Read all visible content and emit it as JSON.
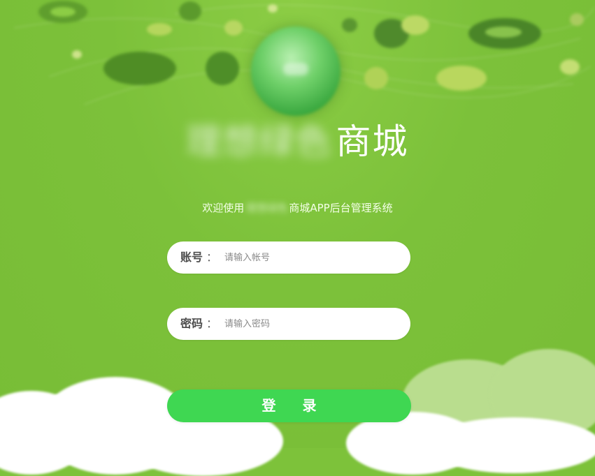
{
  "title": {
    "masked_text": "理想绿色",
    "visible_text": "商城"
  },
  "subtitle": {
    "prefix": "欢迎使用",
    "masked_text": "理想绿色",
    "suffix": "商城APP后台管理系统"
  },
  "account": {
    "label": "账号",
    "colon": "：",
    "placeholder": "请输入帐号",
    "value": ""
  },
  "password": {
    "label": "密码",
    "colon": "：",
    "placeholder": "请输入密码",
    "value": ""
  },
  "login_button": {
    "label": "登录"
  },
  "colors": {
    "background": "#7dc23a",
    "button": "#3fd752",
    "input_bg": "#ffffff"
  }
}
